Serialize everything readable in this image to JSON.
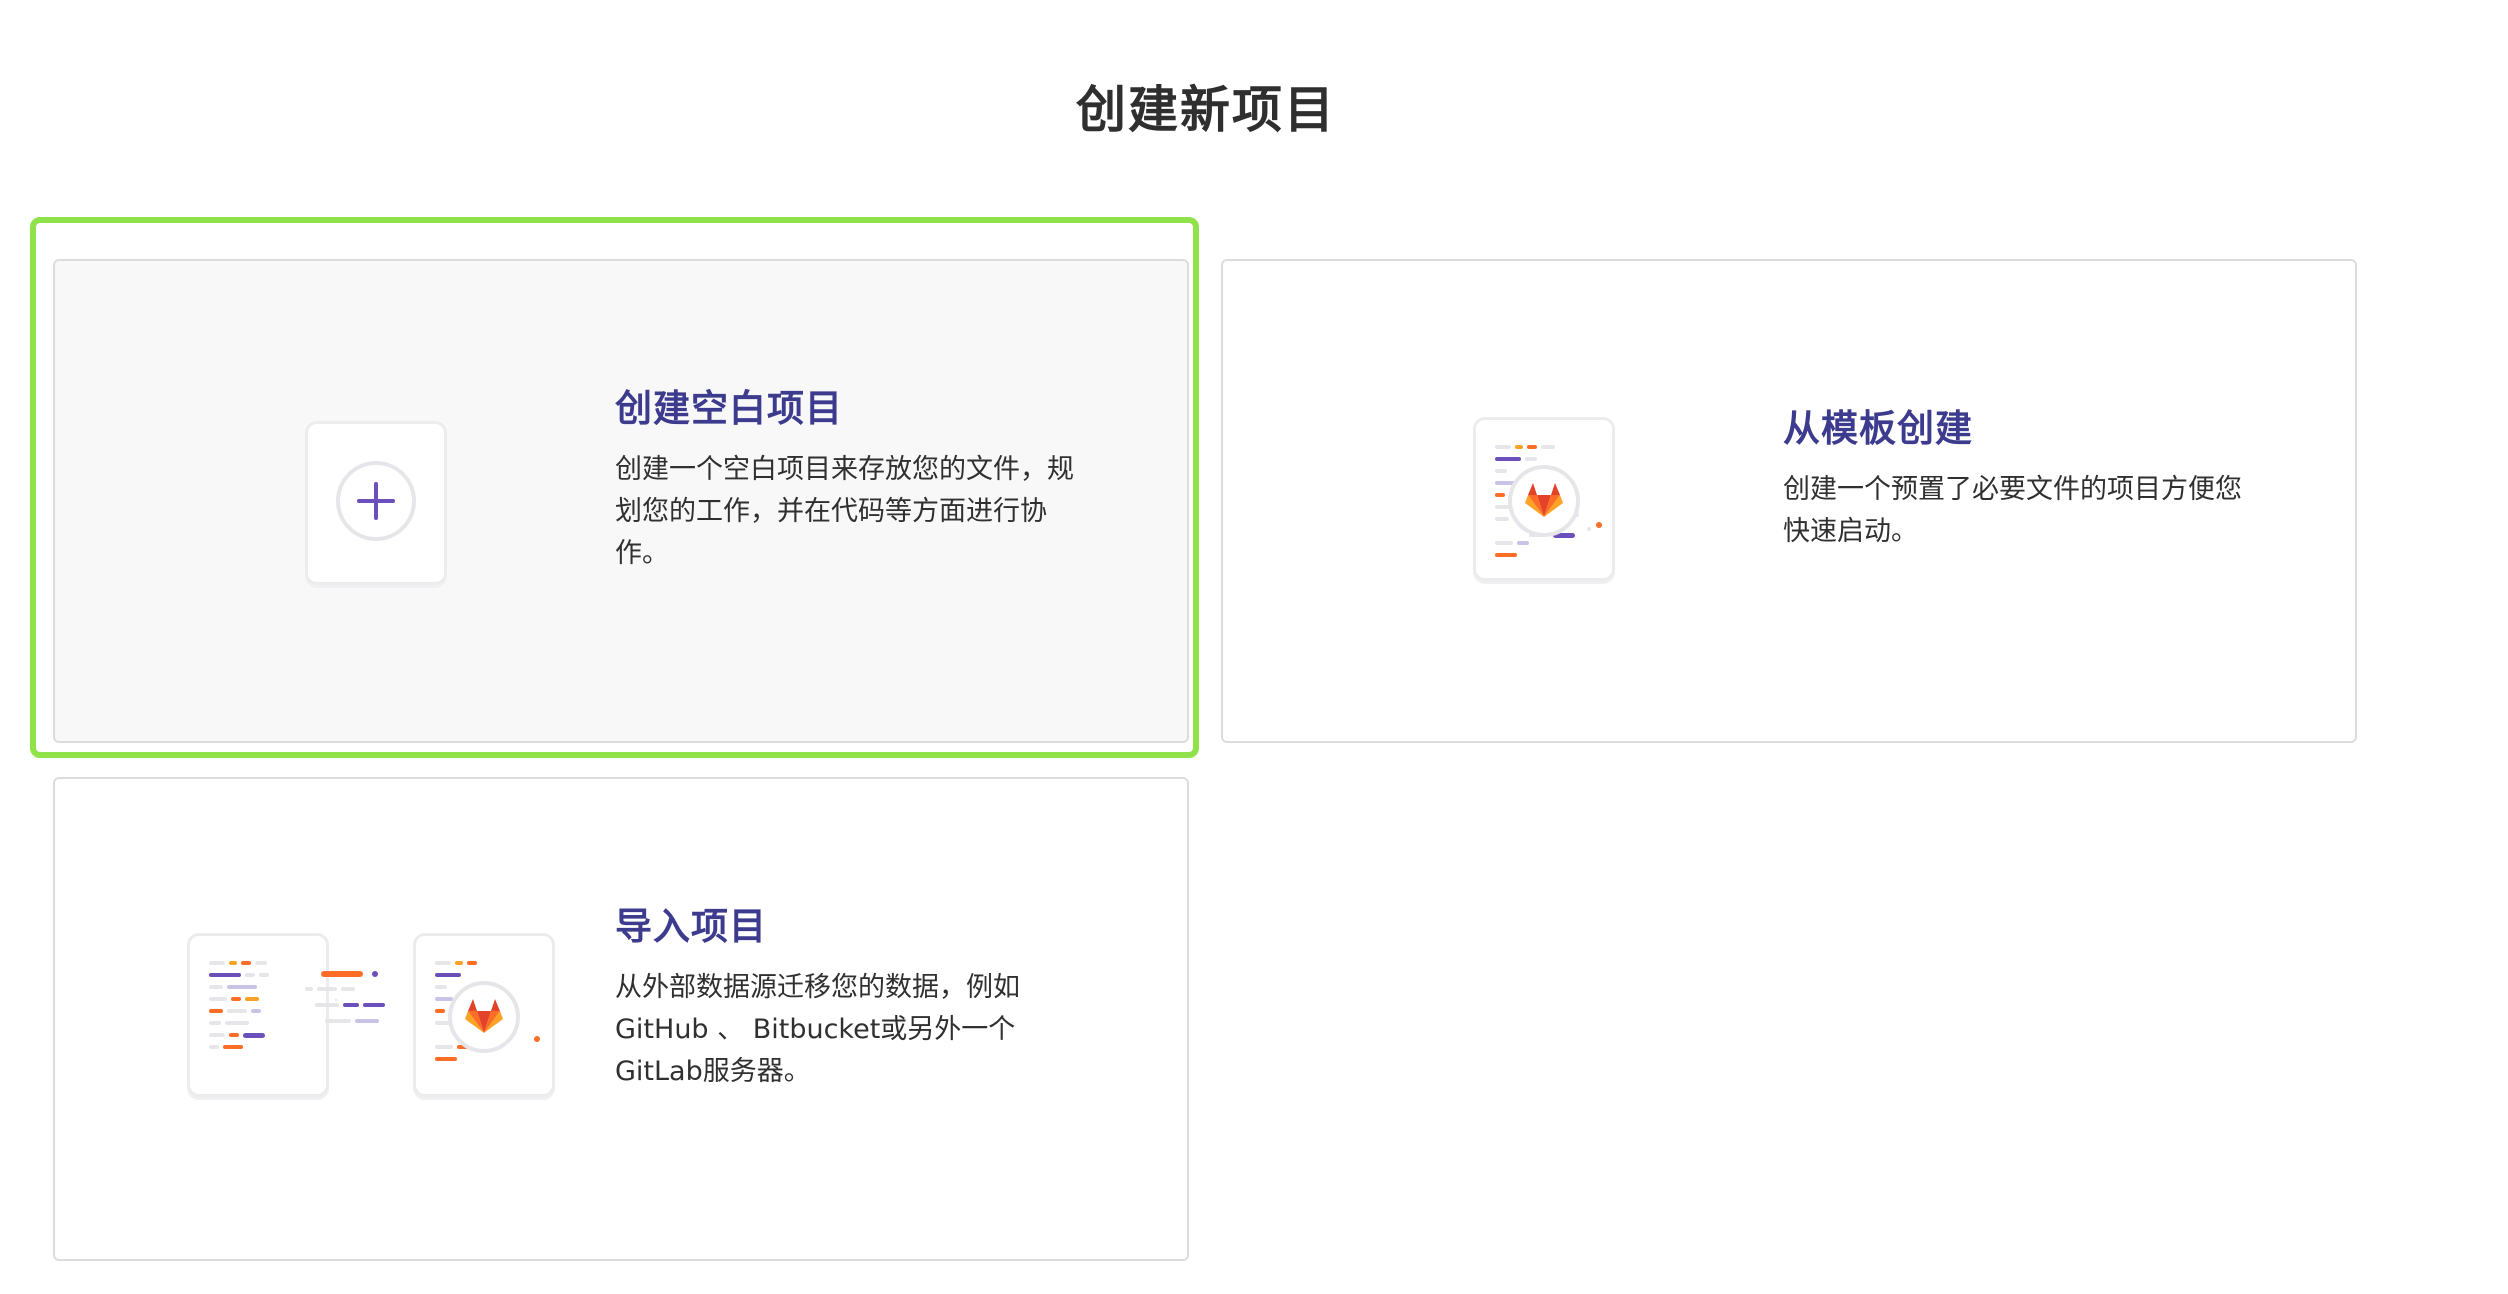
{
  "page": {
    "title": "创建新项目"
  },
  "cards": [
    {
      "id": "blank",
      "title": "创建空白项目",
      "description": "创建一个空白项目来存放您的文件，规划您的工作，并在代码等方面进行协作。",
      "icon": "plus-icon",
      "selected": true
    },
    {
      "id": "template",
      "title": "从模板创建",
      "description": "创建一个预置了必要文件的项目方便您快速启动。",
      "icon": "gitlab-template-icon",
      "selected": false
    },
    {
      "id": "import",
      "title": "导入项目",
      "description": "从外部数据源迁移您的数据，例如 GitHub 、 Bitbucket或另外一个 GitLab服务器。",
      "icon": "import-icon",
      "selected": false
    }
  ],
  "colors": {
    "accent": "#3d3b8e",
    "focus_ring": "#90e24a",
    "gitlab_orange": "#e24329",
    "gitlab_light_orange": "#fc6d26",
    "gitlab_yellow": "#fca326",
    "code_purple": "#6b4fbb",
    "code_orange": "#fc6d26"
  }
}
